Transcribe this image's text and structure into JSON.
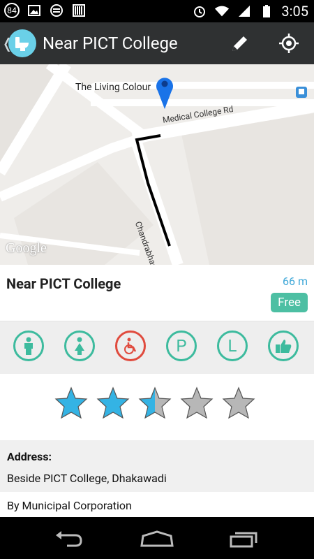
{
  "status_bar": {
    "notification_badge": "84",
    "time": "3:05"
  },
  "app_bar": {
    "title": "Near PICT College",
    "back_glyph": "❬"
  },
  "map": {
    "poi_label": "The Living Colour",
    "street_labels": [
      "Medical College Rd",
      "Chandrabhaga Nagar Rd"
    ],
    "attribution": "Google"
  },
  "details": {
    "name": "Near PICT College",
    "distance": "66 m",
    "price": "Free"
  },
  "facilities": [
    {
      "name": "male-icon"
    },
    {
      "name": "female-icon"
    },
    {
      "name": "wheelchair-icon"
    },
    {
      "name": "parking-icon",
      "label": "P"
    },
    {
      "name": "ladies-icon",
      "label": "L"
    },
    {
      "name": "thumbs-up-icon"
    }
  ],
  "rating": {
    "value": 2.5,
    "max": 5
  },
  "address": {
    "label": "Address:",
    "value": "Beside PICT College, Dhakawadi"
  },
  "owner": {
    "text": "By Municipal Corporation"
  },
  "colors": {
    "accent_teal": "#4dbfa3",
    "accent_blue": "#40a8d8",
    "star_blue": "#34b3e4",
    "star_gray": "#b7b7b7",
    "wheelchair_red": "#e04b3e"
  }
}
